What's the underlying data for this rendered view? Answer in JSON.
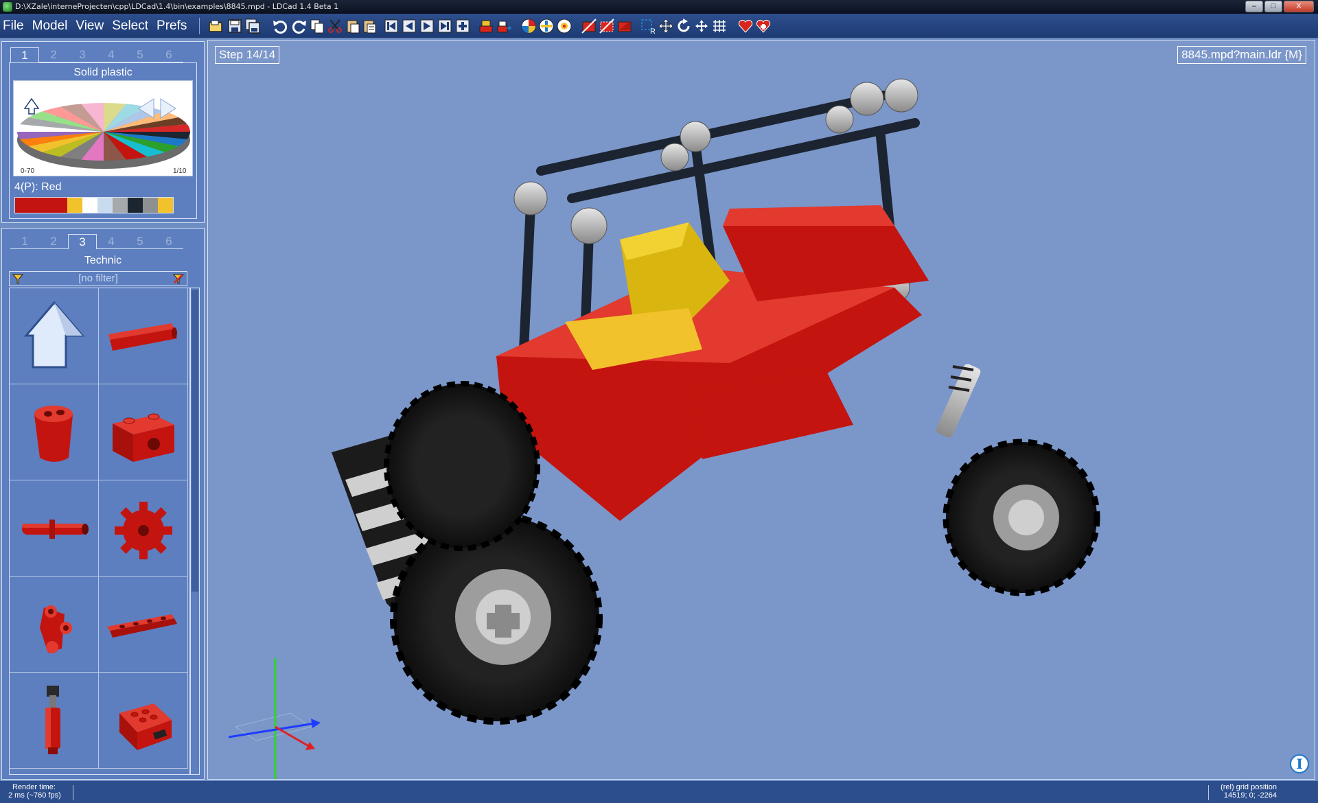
{
  "titlebar": {
    "title": "D:\\XZale\\interneProjecten\\cpp\\LDCad\\1.4\\bin\\examples\\8845.mpd - LDCad 1.4 Beta 1",
    "minimize": "–",
    "maximize": "□",
    "close": "X"
  },
  "menu": {
    "items": [
      "File",
      "Model",
      "View",
      "Select",
      "Prefs"
    ]
  },
  "toolbar": {
    "icons": [
      "open-icon",
      "save-icon",
      "save-all-icon",
      "undo-icon",
      "redo-icon",
      "copy-icon",
      "cut-icon",
      "paste-icon",
      "paste-special-icon",
      "step-first-icon",
      "step-prev-icon",
      "step-next-icon",
      "step-last-icon",
      "step-add-icon",
      "submodel-icon",
      "submodel-add-icon",
      "color-bin-icon",
      "part-bin-icon",
      "group-icon",
      "hide-icon",
      "hide-selection-icon",
      "unhide-icon",
      "select-region-icon",
      "move-icon",
      "rotate-icon",
      "pan-icon",
      "grid-icon",
      "favorite-icon",
      "favorite-add-icon"
    ]
  },
  "color_panel": {
    "tabs": [
      "1",
      "2",
      "3",
      "4",
      "5",
      "6"
    ],
    "active_tab": "1",
    "group_name": "Solid plastic",
    "range_left": "0-70",
    "range_right": "1/10",
    "current_color": "4(P): Red",
    "palette": [
      "#c4140f",
      "#c4140f",
      "#c4140f",
      "#c4140f",
      "#f2c22d",
      "#ffffff",
      "#c9dcef",
      "#a5a9ab",
      "#1b2630",
      "#8f9091",
      "#f2c22d"
    ]
  },
  "parts_panel": {
    "tabs": [
      "1",
      "2",
      "3",
      "4",
      "5",
      "6"
    ],
    "active_tab": "3",
    "group_name": "Technic",
    "filter": "[no filter]",
    "parts": [
      "up-arrow-icon",
      "technic-beam",
      "technic-connector",
      "technic-brick",
      "technic-pin",
      "technic-gear",
      "technic-liftarm-link",
      "technic-plate",
      "technic-shock-absorber",
      "technic-motor"
    ]
  },
  "viewport": {
    "step": "Step 14/14",
    "file": "8845.mpd?main.ldr {M}",
    "info": "I"
  },
  "status": {
    "render_label": "Render time:",
    "render_value": "2 ms (~760 fps)",
    "grid_label": "(rel) grid position",
    "grid_value": "14519; 0; -2264"
  }
}
